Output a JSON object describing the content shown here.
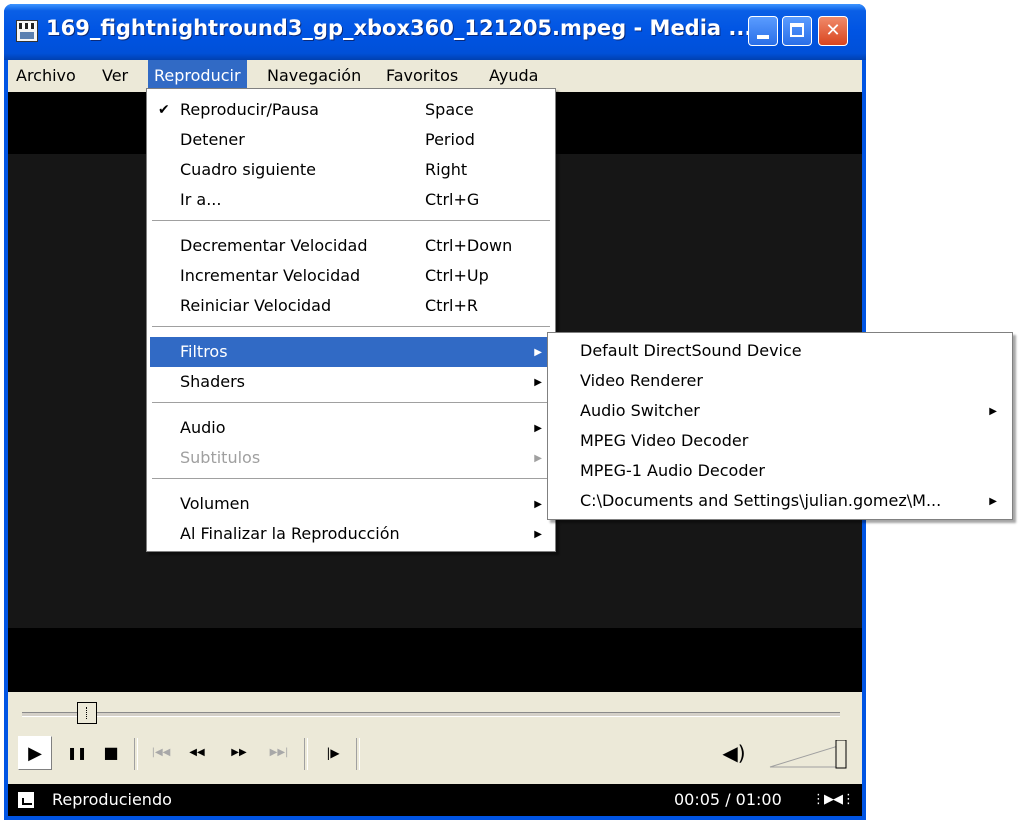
{
  "window": {
    "title": "169_fightnightround3_gp_xbox360_121205.mpeg - Media ...",
    "controls": {
      "minimize": "_",
      "maximize": "□",
      "close": "✕"
    }
  },
  "menubar": [
    {
      "label": "Archivo"
    },
    {
      "label": "Ver"
    },
    {
      "label": "Reproducir"
    },
    {
      "label": "Navegación"
    },
    {
      "label": "Favoritos"
    },
    {
      "label": "Ayuda"
    }
  ],
  "reproducir_menu": [
    {
      "label": "Reproducir/Pausa",
      "shortcut": "Space",
      "checked": true
    },
    {
      "label": "Detener",
      "shortcut": "Period"
    },
    {
      "label": "Cuadro siguiente",
      "shortcut": "Right"
    },
    {
      "label": "Ir a...",
      "shortcut": "Ctrl+G"
    },
    {
      "label": "Decrementar Velocidad",
      "shortcut": "Ctrl+Down"
    },
    {
      "label": "Incrementar Velocidad",
      "shortcut": "Ctrl+Up"
    },
    {
      "label": "Reiniciar Velocidad",
      "shortcut": "Ctrl+R"
    },
    {
      "label": "Filtros",
      "has_submenu": true,
      "highlighted": true
    },
    {
      "label": "Shaders",
      "has_submenu": true
    },
    {
      "label": "Audio",
      "has_submenu": true
    },
    {
      "label": "Subtitulos",
      "has_submenu": true,
      "disabled": true
    },
    {
      "label": "Volumen",
      "has_submenu": true
    },
    {
      "label": "Al Finalizar la Reproducción",
      "has_submenu": true
    }
  ],
  "filtros_submenu": [
    {
      "label": "Default DirectSound Device"
    },
    {
      "label": "Video Renderer"
    },
    {
      "label": "Audio Switcher",
      "has_submenu": true
    },
    {
      "label": "MPEG Video Decoder"
    },
    {
      "label": "MPEG-1 Audio Decoder"
    },
    {
      "label": "C:\\Documents and Settings\\julian.gomez\\M...",
      "has_submenu": true
    }
  ],
  "playback": {
    "position_fraction": 0.08,
    "volume_fraction": 1.0
  },
  "status": {
    "text": "Reproduciendo",
    "time": "00:05 / 01:00"
  },
  "icons": {
    "checkmark": "✔",
    "submenu_arrow": "▶",
    "play": "▶",
    "pause": "❚❚",
    "stop": "■",
    "skip_back": "|◀◀",
    "rewind": "◀◀",
    "fast_forward": "▶▶",
    "skip_forward": "▶▶|",
    "frame_step": "|▶",
    "speaker": "◀)",
    "rate": "⋮▶◀⋮"
  },
  "colors": {
    "title_bar": "#0054e3",
    "menu_highlight": "#316ac5",
    "menu_background": "#ffffff",
    "menubar_background": "#ece9d8",
    "close_button": "#d9451f"
  }
}
